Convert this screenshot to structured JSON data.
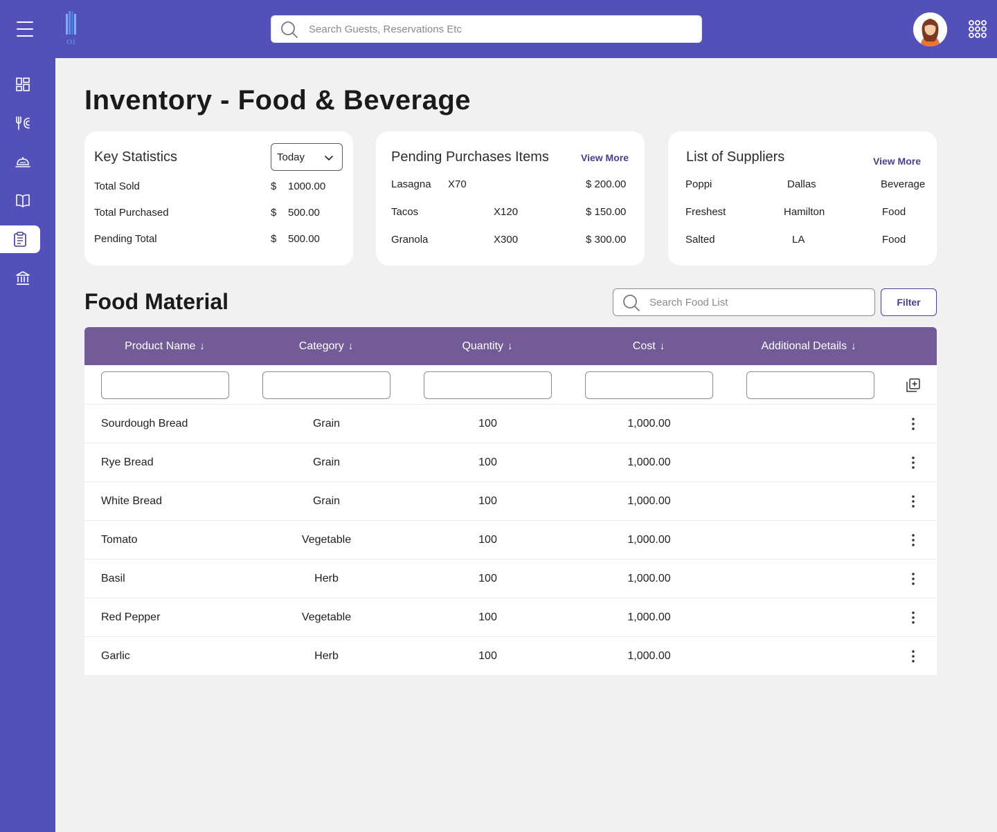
{
  "app": {
    "logo_text": "OI",
    "search_placeholder": "Search Guests, Reservations Etc"
  },
  "page_title": "Inventory - Food & Beverage",
  "key_statistics": {
    "title": "Key Statistics",
    "period": "Today",
    "rows": [
      {
        "label": "Total Sold",
        "currency": "$",
        "value": "1000.00"
      },
      {
        "label": "Total Purchased",
        "currency": "$",
        "value": "500.00"
      },
      {
        "label": "Pending Total",
        "currency": "$",
        "value": "500.00"
      }
    ]
  },
  "pending_purchases": {
    "title": "Pending Purchases Items",
    "view_more": "View More",
    "rows": [
      {
        "item": "Lasagna",
        "qty": "X70",
        "price": "$ 200.00"
      },
      {
        "item": "Tacos",
        "qty": "X120",
        "price": "$ 150.00"
      },
      {
        "item": "Granola",
        "qty": "X300",
        "price": "$ 300.00"
      }
    ]
  },
  "suppliers": {
    "title": "List of Suppliers",
    "view_more": "View More",
    "rows": [
      {
        "name": "Poppi",
        "location": "Dallas",
        "type": "Beverage"
      },
      {
        "name": "Freshest",
        "location": "Hamilton",
        "type": "Food"
      },
      {
        "name": "Salted",
        "location": "LA",
        "type": "Food"
      }
    ]
  },
  "food_material": {
    "title": "Food Material",
    "search_placeholder": "Search Food List",
    "filter_label": "Filter",
    "columns": [
      "Product Name",
      "Category",
      "Quantity",
      "Cost",
      "Additional Details"
    ],
    "sort_arrow": "↓",
    "rows": [
      {
        "name": "Sourdough Bread",
        "category": "Grain",
        "quantity": "100",
        "cost": "1,000.00"
      },
      {
        "name": "Rye Bread",
        "category": "Grain",
        "quantity": "100",
        "cost": "1,000.00"
      },
      {
        "name": "White Bread",
        "category": "Grain",
        "quantity": "100",
        "cost": "1,000.00"
      },
      {
        "name": "Tomato",
        "category": "Vegetable",
        "quantity": "100",
        "cost": "1,000.00"
      },
      {
        "name": "Basil",
        "category": "Herb",
        "quantity": "100",
        "cost": "1,000.00"
      },
      {
        "name": "Red Pepper",
        "category": "Vegetable",
        "quantity": "100",
        "cost": "1,000.00"
      },
      {
        "name": "Garlic",
        "category": "Herb",
        "quantity": "100",
        "cost": "1,000.00"
      }
    ]
  },
  "sidebar_icons": [
    "dashboard-icon",
    "restaurant-icon",
    "room-service-icon",
    "book-icon",
    "clipboard-icon",
    "bank-icon"
  ],
  "colors": {
    "brand": "#5350b9",
    "table_header": "#735b98",
    "accent": "#4b3c8e",
    "background": "#f1f1f1"
  }
}
